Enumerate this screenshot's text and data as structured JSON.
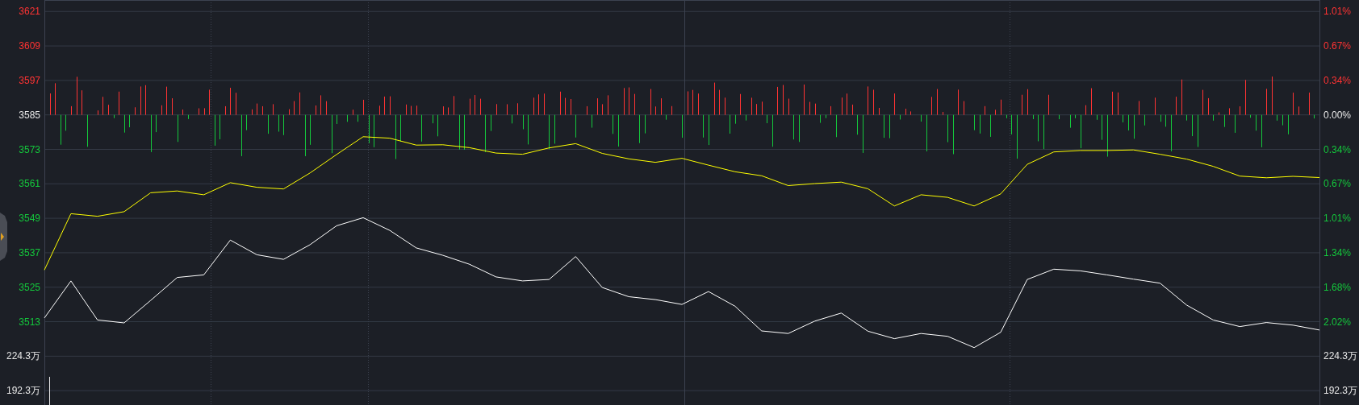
{
  "chart_data": {
    "type": "line",
    "ylim": [
      3484,
      3625
    ],
    "categories": [
      null,
      null,
      null,
      null,
      null,
      null,
      null,
      null,
      null,
      null,
      null,
      null,
      null,
      null,
      null,
      null,
      null,
      null,
      null,
      null,
      null,
      null,
      null,
      null,
      null,
      null,
      null,
      null,
      null,
      null,
      null,
      null,
      null,
      null,
      null,
      null,
      null,
      null,
      null,
      null,
      null,
      null,
      null,
      null,
      null,
      null,
      null,
      null,
      null
    ],
    "yticks": [
      3621,
      3609,
      3597,
      3585,
      3573,
      3561,
      3549,
      3537,
      3525,
      3513
    ],
    "series": [
      {
        "color": "#ffffff",
        "values": [
          3514.3,
          3527.2,
          3513.6,
          3512.6,
          3520.4,
          3528.4,
          3529.3,
          3541.4,
          3536.3,
          3534.7,
          3539.8,
          3546.4,
          3549.2,
          3544.8,
          3538.7,
          3536.1,
          3533.0,
          3528.6,
          3527.2,
          3527.7,
          3535.7,
          3524.9,
          3521.7,
          3520.7,
          3519.0,
          3523.5,
          3518.4,
          3509.8,
          3508.9,
          3513.2,
          3516.0,
          3509.7,
          3507.1,
          3508.9,
          3507.9,
          3504.0,
          3509.3,
          3527.7,
          3531.3,
          3530.7,
          3529.3,
          3527.8,
          3526.4,
          3518.8,
          3513.6,
          3511.3,
          3512.7,
          3511.8,
          3510.1
        ]
      },
      {
        "color": "#ffff00",
        "values": [
          3531.0,
          3550.6,
          3549.7,
          3551.3,
          3557.9,
          3558.5,
          3557.2,
          3561.4,
          3559.8,
          3559.2,
          3564.8,
          3571.2,
          3577.4,
          3576.9,
          3574.5,
          3574.6,
          3573.6,
          3571.7,
          3571.3,
          3573.5,
          3575.0,
          3571.6,
          3569.7,
          3568.5,
          3569.9,
          3567.5,
          3565.2,
          3563.8,
          3560.4,
          3561.1,
          3561.6,
          3559.3,
          3553.3,
          3557.2,
          3556.3,
          3553.3,
          3557.5,
          3567.8,
          3572.1,
          3572.6,
          3572.6,
          3572.8,
          3571.3,
          3569.6,
          3567.1,
          3563.7,
          3563.1,
          3563.6,
          3563.2
        ]
      }
    ]
  },
  "left_axis": [
    {
      "label": "3621",
      "color": "#ff3333"
    },
    {
      "label": "3609",
      "color": "#ff3333"
    },
    {
      "label": "3597",
      "color": "#ff3333"
    },
    {
      "label": "3585",
      "color": "#e8e8e8"
    },
    {
      "label": "3573",
      "color": "#14c83c"
    },
    {
      "label": "3561",
      "color": "#14c83c"
    },
    {
      "label": "3549",
      "color": "#14c83c"
    },
    {
      "label": "3537",
      "color": "#14c83c"
    },
    {
      "label": "3525",
      "color": "#14c83c"
    },
    {
      "label": "3513",
      "color": "#14c83c"
    }
  ],
  "right_axis": [
    {
      "label": "1.01%",
      "color": "#ff3333"
    },
    {
      "label": "0.67%",
      "color": "#ff3333"
    },
    {
      "label": "0.34%",
      "color": "#ff3333"
    },
    {
      "label": "0.00%",
      "color": "#e8e8e8"
    },
    {
      "label": "0.34%",
      "color": "#14c83c"
    },
    {
      "label": "0.67%",
      "color": "#14c83c"
    },
    {
      "label": "1.01%",
      "color": "#14c83c"
    },
    {
      "label": "1.34%",
      "color": "#14c83c"
    },
    {
      "label": "1.68%",
      "color": "#14c83c"
    },
    {
      "label": "2.02%",
      "color": "#14c83c"
    }
  ],
  "volume_axis_left": [
    "224.3万",
    "192.3万"
  ],
  "volume_axis_right": [
    "224.3万",
    "192.3万"
  ]
}
